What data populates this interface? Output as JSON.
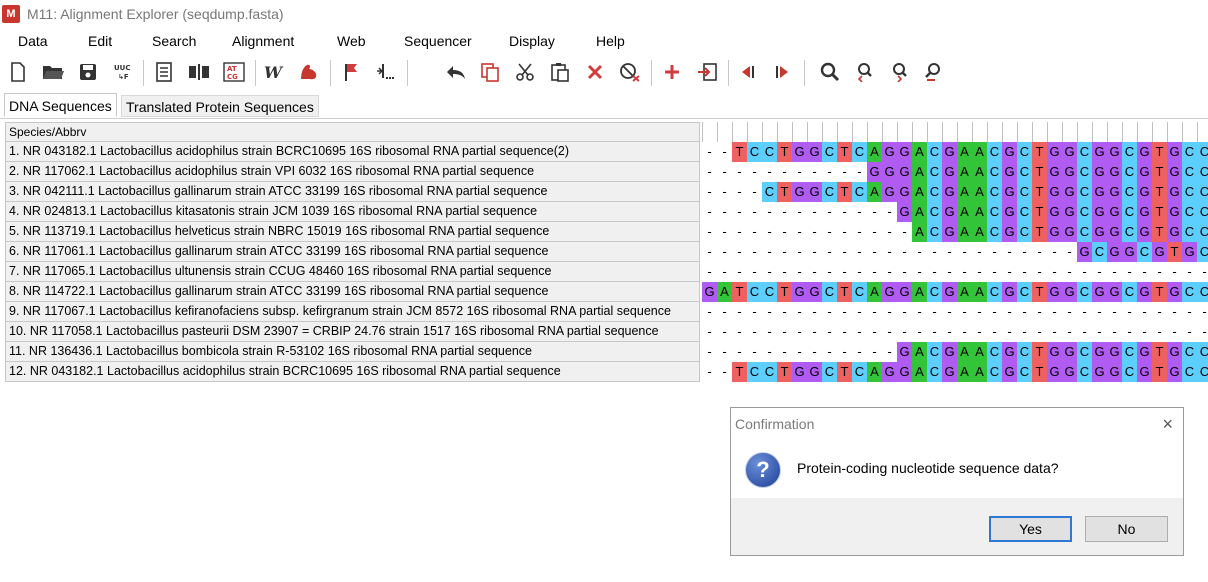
{
  "window": {
    "title": "M11: Alignment Explorer (seqdump.fasta)",
    "logo": "M"
  },
  "menu": [
    "Data",
    "Edit",
    "Search",
    "Alignment",
    "Web",
    "Sequencer",
    "Display",
    "Help"
  ],
  "toolbar_icons": [
    "new-file-icon",
    "open-folder-icon",
    "save-disk-icon",
    "translate-uuc-icon",
    "document-list-icon",
    "align-columns-icon",
    "atcg-icon",
    "muscle-w-icon",
    "muscle-arm-icon",
    "flag-icon",
    "insert-gap-icon",
    "undo-icon",
    "copy-icon",
    "cut-icon",
    "paste-icon",
    "delete-icon",
    "clear-block-icon",
    "add-sequence-icon",
    "import-icon",
    "move-left-icon",
    "move-right-icon",
    "search-icon",
    "find-previous-icon",
    "find-next-icon",
    "find-motif-icon"
  ],
  "tabs": [
    {
      "label": "DNA Sequences",
      "active": true
    },
    {
      "label": "Translated Protein Sequences",
      "active": false
    }
  ],
  "names_header": "Species/Abbrv",
  "sequences": [
    {
      "name": "1. NR 043182.1 Lactobacillus acidophilus strain BCRC10695 16S ribosomal RNA partial sequence(2)",
      "seq": "--TCCTGGCTCAGGACGAACGCTGGCGGCGTGCC"
    },
    {
      "name": "2. NR 117062.1 Lactobacillus acidophilus strain VPI 6032 16S ribosomal RNA partial sequence",
      "seq": "-----------GGGACGAACGCTGGCGGCGTGCC"
    },
    {
      "name": "3. NR 042111.1 Lactobacillus gallinarum strain ATCC 33199 16S ribosomal RNA partial sequence",
      "seq": "----CTGGCTCAGGACGAACGCTGGCGGCGTGCC"
    },
    {
      "name": "4. NR 024813.1 Lactobacillus kitasatonis strain JCM 1039 16S ribosomal RNA partial sequence",
      "seq": "-------------GACGAACGCTGGCGGCGTGCC"
    },
    {
      "name": "5. NR 113719.1 Lactobacillus helveticus strain NBRC 15019 16S ribosomal RNA partial sequence",
      "seq": "--------------ACGAACGCTGGCGGCGTGCC"
    },
    {
      "name": "6. NR 117061.1 Lactobacillus gallinarum strain ATCC 33199 16S ribosomal RNA partial sequence",
      "seq": "-------------------------GCGGCGTGCC"
    },
    {
      "name": "7. NR 117065.1 Lactobacillus ultunensis strain CCUG 48460 16S ribosomal RNA partial sequence",
      "seq": "----------------------------------"
    },
    {
      "name": "8. NR 114722.1 Lactobacillus gallinarum strain ATCC 33199 16S ribosomal RNA partial sequence",
      "seq": "GATCCTGGCTCAGGACGAACGCTGGCGGCGTGCC"
    },
    {
      "name": "9. NR 117067.1 Lactobacillus kefiranofaciens subsp. kefirgranum strain JCM 8572 16S ribosomal RNA partial sequence",
      "seq": "----------------------------------"
    },
    {
      "name": "10. NR 117058.1 Lactobacillus pasteurii DSM 23907 = CRBIP 24.76 strain 1517 16S ribosomal RNA partial sequence",
      "seq": "----------------------------------"
    },
    {
      "name": "11. NR 136436.1 Lactobacillus bombicola strain R-53102 16S ribosomal RNA partial sequence",
      "seq": "-------------GACGAACGCTGGCGGCGTGCC"
    },
    {
      "name": "12. NR 043182.1 Lactobacillus acidophilus strain BCRC10695 16S ribosomal RNA partial sequence",
      "seq": "--TCCTGGCTCAGGACGAACGCTGGCGGCGTGCC"
    }
  ],
  "base_colors": {
    "A": "#33c43a",
    "C": "#5ccfff",
    "G": "#b05cf2",
    "T": "#ef6060"
  },
  "dialog": {
    "title": "Confirmation",
    "close_label": "×",
    "icon": "question-icon",
    "icon_glyph": "?",
    "message": "Protein-coding nucleotide sequence data?",
    "yes_label": "Yes",
    "no_label": "No"
  }
}
